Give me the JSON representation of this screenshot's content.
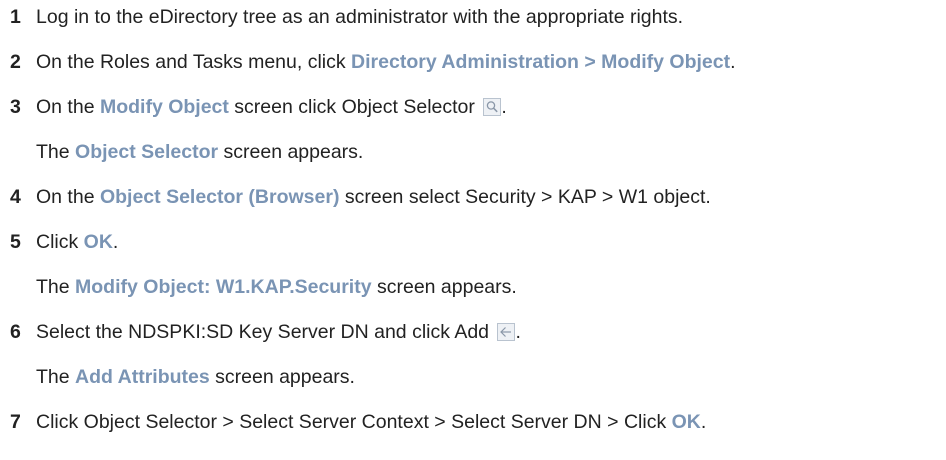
{
  "steps": [
    {
      "num": "1",
      "parts": [
        "Log in to the eDirectory tree as an administrator with the appropriate rights."
      ]
    },
    {
      "num": "2",
      "a": "On the Roles and Tasks menu, click ",
      "b": "Directory Administration > Modify Object",
      "c": "."
    },
    {
      "num": "3",
      "a": "On the ",
      "b": "Modify Object",
      "c": " screen click Object Selector ",
      "d": "."
    },
    {
      "a": "The ",
      "b": "Object Selector",
      "c": " screen appears."
    },
    {
      "num": "4",
      "a": "On the ",
      "b": "Object Selector (Browser)",
      "c": " screen select Security > KAP > W1 object."
    },
    {
      "num": "5",
      "a": "Click ",
      "b": "OK",
      "c": "."
    },
    {
      "a": "The ",
      "b": "Modify Object: W1.KAP.Security",
      "c": " screen appears."
    },
    {
      "num": "6",
      "a": "Select the NDSPKI:SD Key Server DN and click Add ",
      "d": "."
    },
    {
      "a": "The ",
      "b": "Add Attributes",
      "c": " screen appears."
    },
    {
      "num": "7",
      "a": "Click Object Selector > Select Server Context > Select Server DN > Click ",
      "b": "OK",
      "c": "."
    }
  ],
  "icons": {
    "object_selector": "magnifier-icon",
    "add": "left-arrow-icon"
  },
  "colors": {
    "ui_element": "#7a94b4",
    "text": "#222222"
  }
}
